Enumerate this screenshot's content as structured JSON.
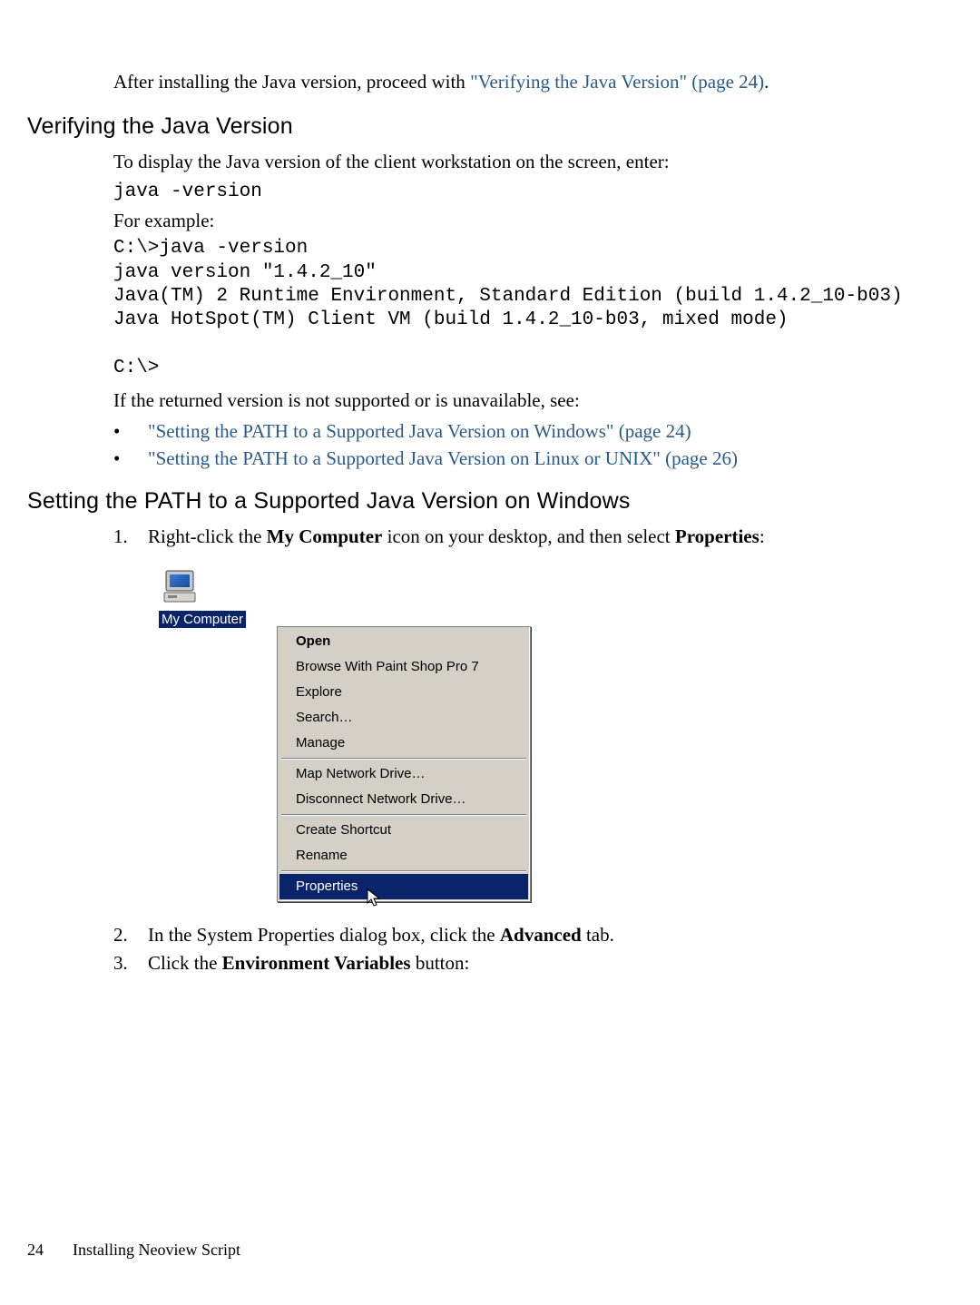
{
  "intro_prefix": "After installing the Java version, proceed with ",
  "intro_link": "\"Verifying the Java Version\" (page 24)",
  "intro_suffix": ".",
  "section1_heading": "Verifying the Java Version",
  "section1_p1": "To display the Java version of the client workstation on the screen, enter:",
  "code_cmd": "java -version",
  "for_example": "For example:",
  "code_output": "C:\\>java -version\njava version \"1.4.2_10\"\nJava(TM) 2 Runtime Environment, Standard Edition (build 1.4.2_10-b03)\nJava HotSpot(TM) Client VM (build 1.4.2_10-b03, mixed mode)\n\nC:\\>",
  "section1_p2": "If the returned version is not supported or is unavailable, see:",
  "bullets": [
    "\"Setting the PATH to a Supported Java Version on Windows\" (page 24)",
    "\"Setting the PATH to a Supported Java Version on Linux or UNIX\" (page 26)"
  ],
  "section2_heading": "Setting the PATH to a Supported Java Version on Windows",
  "step1_num": "1.",
  "step1_pre": "Right-click the ",
  "step1_b1": "My Computer",
  "step1_mid": " icon on your desktop, and then select ",
  "step1_b2": "Properties",
  "step1_post": ":",
  "mycomputer_label": "My Computer",
  "menu": {
    "open": "Open",
    "browse": "Browse With Paint Shop Pro 7",
    "explore": "Explore",
    "search": "Search…",
    "manage": "Manage",
    "map": "Map Network Drive…",
    "disconnect": "Disconnect Network Drive…",
    "shortcut": "Create Shortcut",
    "rename": "Rename",
    "properties": "Properties"
  },
  "step2_num": "2.",
  "step2_pre": "In the System Properties dialog box, click the ",
  "step2_b": "Advanced",
  "step2_post": " tab.",
  "step3_num": "3.",
  "step3_pre": "Click the ",
  "step3_b": "Environment Variables",
  "step3_post": " button:",
  "footer_page": "24",
  "footer_title": "Installing Neoview Script"
}
